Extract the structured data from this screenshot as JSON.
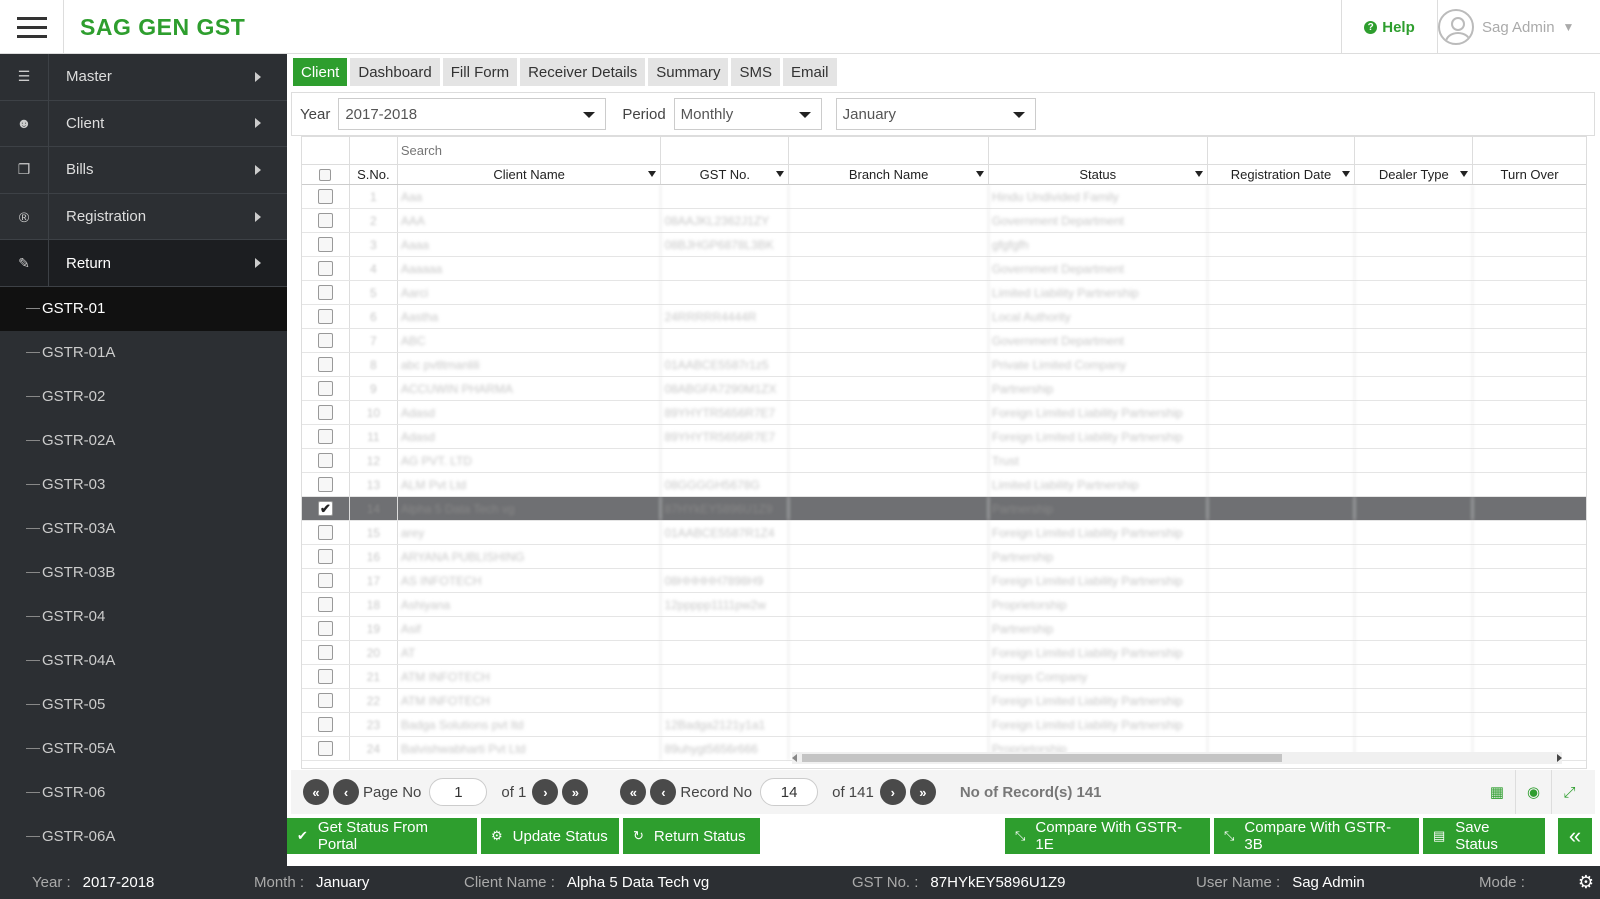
{
  "header": {
    "app_title": "SAG GEN GST",
    "help_label": "Help",
    "user_name": "Sag Admin"
  },
  "sidebar": {
    "main_items": [
      {
        "label": "Master",
        "icon": "database-icon"
      },
      {
        "label": "Client",
        "icon": "users-icon"
      },
      {
        "label": "Bills",
        "icon": "copy-icon"
      },
      {
        "label": "Registration",
        "icon": "registered-icon"
      },
      {
        "label": "Return",
        "icon": "edit-icon",
        "active": true
      }
    ],
    "sub_items": [
      "GSTR-01",
      "GSTR-01A",
      "GSTR-02",
      "GSTR-02A",
      "GSTR-03",
      "GSTR-03A",
      "GSTR-03B",
      "GSTR-04",
      "GSTR-04A",
      "GSTR-05",
      "GSTR-05A",
      "GSTR-06",
      "GSTR-06A"
    ],
    "active_sub": "GSTR-01"
  },
  "tabs": [
    "Client",
    "Dashboard",
    "Fill Form",
    "Receiver Details",
    "Summary",
    "SMS",
    "Email"
  ],
  "filters": {
    "year_label": "Year",
    "year_value": "2017-2018",
    "period_label": "Period",
    "period_value": "Monthly",
    "month_value": "January"
  },
  "grid": {
    "search_placeholder": "Search",
    "columns": [
      "S.No.",
      "Client Name",
      "GST No.",
      "Branch Name",
      "Status",
      "Registration Date",
      "Dealer Type",
      "Turn Over"
    ],
    "rows": [
      {
        "sn": "1",
        "name": "Aaa",
        "gst": "",
        "status": "Hindu Undivided Family",
        "checked": false
      },
      {
        "sn": "2",
        "name": "AAA",
        "gst": "08AAJKL2362J1ZY",
        "status": "Government Department",
        "checked": false
      },
      {
        "sn": "3",
        "name": "Aaaa",
        "gst": "08BJHGP6878L3BK",
        "status": "gfgfgfh",
        "checked": false
      },
      {
        "sn": "4",
        "name": "Aaaaaa",
        "gst": "",
        "status": "Government Department",
        "checked": false
      },
      {
        "sn": "5",
        "name": "Aarci",
        "gst": "",
        "status": "Limited Liability Partnership",
        "checked": false
      },
      {
        "sn": "6",
        "name": "Aastha",
        "gst": "24RRRRR4444R",
        "status": "Local Authority",
        "checked": false
      },
      {
        "sn": "7",
        "name": "ABC",
        "gst": "",
        "status": "Government Department",
        "checked": false
      },
      {
        "sn": "8",
        "name": "abc pvtltmanlili",
        "gst": "01AABCE5587r1z5",
        "status": "Private Limited Company",
        "checked": false
      },
      {
        "sn": "9",
        "name": "ACCUWIN PHARMA",
        "gst": "08ABGFA7290M1ZX",
        "status": "Partnership",
        "checked": false
      },
      {
        "sn": "10",
        "name": "Adasd",
        "gst": "89YHYTR5656R7E7",
        "status": "Foreign Limited Liability Partnership",
        "checked": false
      },
      {
        "sn": "11",
        "name": "Adasd",
        "gst": "89YHYTR5656R7E7",
        "status": "Foreign Limited Liability Partnership",
        "checked": false
      },
      {
        "sn": "12",
        "name": "AG PVT. LTD",
        "gst": "",
        "status": "Trust",
        "checked": false
      },
      {
        "sn": "13",
        "name": "ALM Pvt Ltd",
        "gst": "08GGGGH5678G",
        "status": "Limited Liability Partnership",
        "checked": false
      },
      {
        "sn": "14",
        "name": "Alpha 5 Data Tech vg",
        "gst": "87HYkEY5896U1Z9",
        "status": "Partnership",
        "checked": true
      },
      {
        "sn": "15",
        "name": "arey",
        "gst": "01AABCE5587R1Z4",
        "status": "Foreign Limited Liability Partnership",
        "checked": false
      },
      {
        "sn": "16",
        "name": "ARYANA PUBLISHING",
        "gst": "",
        "status": "Partnership",
        "checked": false
      },
      {
        "sn": "17",
        "name": "AS INFOTECH",
        "gst": "08HHHHH7898H9",
        "status": "Foreign Limited Liability Partnership",
        "checked": false
      },
      {
        "sn": "18",
        "name": "Ashiyana",
        "gst": "12ppppp1111pw2w",
        "status": "Proprietorship",
        "checked": false
      },
      {
        "sn": "19",
        "name": "Asif",
        "gst": "",
        "status": "Partnership",
        "checked": false
      },
      {
        "sn": "20",
        "name": "AT",
        "gst": "",
        "status": "Foreign Limited Liability Partnership",
        "checked": false
      },
      {
        "sn": "21",
        "name": "ATM INFOTECH",
        "gst": "",
        "status": "Foreign Company",
        "checked": false
      },
      {
        "sn": "22",
        "name": "ATM INFOTECH",
        "gst": "",
        "status": "Foreign Limited Liability Partnership",
        "checked": false
      },
      {
        "sn": "23",
        "name": "Badga Solutions pvt ltd",
        "gst": "12Badga2121y1a1",
        "status": "Foreign Limited Liability Partnership",
        "checked": false
      },
      {
        "sn": "24",
        "name": "Balvishwabharti Pvt Ltd",
        "gst": "89uhygt5656r666",
        "status": "Proprietorship",
        "checked": false
      }
    ]
  },
  "pager": {
    "page_label": "Page No",
    "page_value": "1",
    "page_of": "of 1",
    "record_label": "Record No",
    "record_value": "14",
    "record_of": "of 141",
    "records_text": "No of Record(s) 141"
  },
  "actions": {
    "get_status": "Get Status From Portal",
    "update_status": "Update Status",
    "return_status": "Return Status",
    "compare_1e": "Compare With GSTR-1E",
    "compare_3b": "Compare With GSTR-3B",
    "save_status": "Save Status"
  },
  "statusbar": {
    "year_key": "Year :",
    "year_val": "2017-2018",
    "month_key": "Month :",
    "month_val": "January",
    "client_key": "Client Name :",
    "client_val": "Alpha 5 Data Tech vg",
    "gst_key": "GST No. :",
    "gst_val": "87HYkEY5896U1Z9",
    "user_key": "User Name :",
    "user_val": "Sag Admin",
    "mode_key": "Mode :"
  },
  "colors": {
    "accent": "#2e9e2e",
    "sidebar_bg": "#2c2f33",
    "selected_row": "#6f7073"
  }
}
